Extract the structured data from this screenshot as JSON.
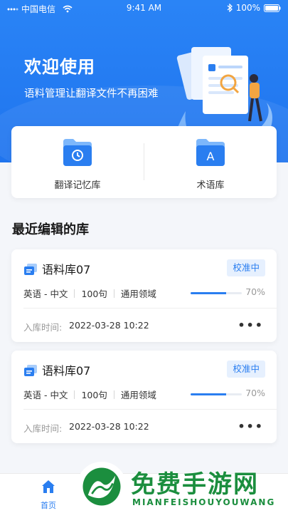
{
  "status_bar": {
    "carrier": "中国电信",
    "time": "9:41 AM",
    "battery": "100%"
  },
  "hero": {
    "title": "欢迎使用",
    "subtitle": "语料管理让翻译文件不再困难"
  },
  "features": [
    {
      "label": "翻译记忆库",
      "icon": "clock-folder-icon"
    },
    {
      "label": "术语库",
      "icon": "letter-a-folder-icon",
      "glyph": "A"
    }
  ],
  "section": {
    "title": "最近编辑的库"
  },
  "libraries": [
    {
      "name": "语料库07",
      "status": "校准中",
      "language": "英语 - 中文",
      "count": "100句",
      "domain": "通用领域",
      "progress": 0.7,
      "progress_text": "70%",
      "date_label": "入库时间:",
      "date": "2022-03-28 10:22",
      "more": "•••"
    },
    {
      "name": "语料库07",
      "status": "校准中",
      "language": "英语 - 中文",
      "count": "100句",
      "domain": "通用领域",
      "progress": 0.7,
      "progress_text": "70%",
      "date_label": "入库时间:",
      "date": "2022-03-28 10:22",
      "more": "•••"
    }
  ],
  "tabbar": {
    "tabs": [
      {
        "label": "首页",
        "icon": "home-icon",
        "active": true
      }
    ]
  },
  "watermark": {
    "text": "免费手游网",
    "sub": "MIANFEISHOUYOUWANG"
  },
  "colors": {
    "primary": "#2a7ef0",
    "hero": "#1f74ee",
    "badge_bg": "#e6f0fe"
  }
}
